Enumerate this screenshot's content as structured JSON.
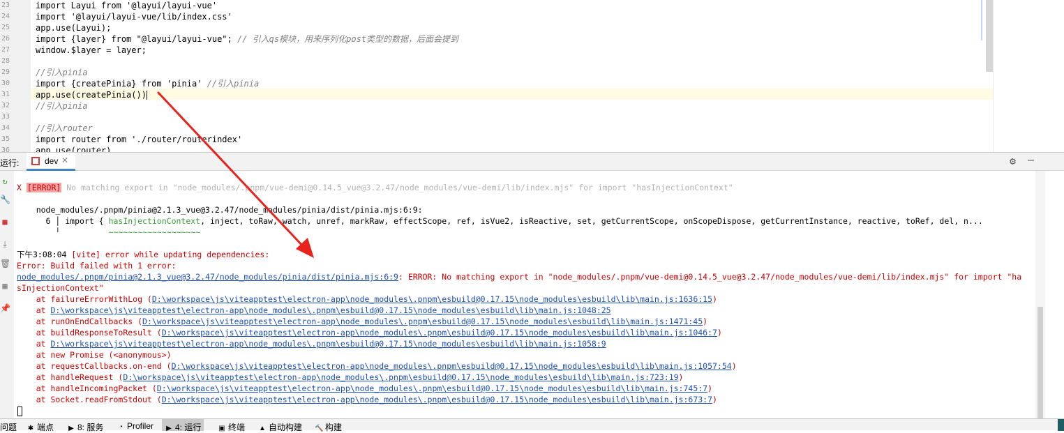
{
  "editor": {
    "line_numbers": [
      "23",
      "24",
      "25",
      "26",
      "27",
      "28",
      "29",
      "30",
      "31",
      "32",
      "33",
      "34",
      "35",
      "36"
    ],
    "lines": [
      {
        "code": "import Layui from '@layui/layui-vue'"
      },
      {
        "code": "import '@layui/layui-vue/lib/index.css'"
      },
      {
        "code": "app.use(Layui);"
      },
      {
        "code": "import {layer} from \"@layui/layui-vue\";",
        "comment": " // 引入qs模块，用来序列化post类型的数据，后面会提到"
      },
      {
        "code": "window.$layer = layer;"
      },
      {
        "code": ""
      },
      {
        "comment": "//引入pinia"
      },
      {
        "code": "import {createPinia} from 'pinia'",
        "comment": " //引入pinia"
      },
      {
        "code": "app.use(createPinia())"
      },
      {
        "comment": "//引入pinia"
      },
      {
        "code": ""
      },
      {
        "comment": "//引入router"
      },
      {
        "code": "import router from './router/routerindex'"
      },
      {
        "code": "app.use(router)"
      }
    ]
  },
  "run_panel": {
    "label": "运行:",
    "tab_label": "dev",
    "close_glyph": "✕",
    "settings_glyph": "⚙",
    "minimize_glyph": "—"
  },
  "console": {
    "line1": {
      "prefix": "X ",
      "badge": "[ERROR]",
      "rest": " No matching export in \"node_modules/.pnpm/vue-demi@0.14.5_vue@3.2.47/node_modules/vue-demi/lib/index.mjs\" for import \"hasInjectionContext\""
    },
    "line2": "    node_modules/.pnpm/pinia@2.1.3_vue@3.2.47/node_modules/pinia/dist/pinia.mjs:6:9:",
    "line3": {
      "prefix": "      6 │ import { ",
      "highlight": "hasInjectionContext",
      "rest": ", inject, toRaw, watch, unref, markRaw, effectScope, ref, isVue2, isReactive, set, getCurrentScope, onScopeDispose, getCurrentInstance, reactive, toRef, del, n..."
    },
    "line4": {
      "prefix": "        ╵          ",
      "wave": "~~~~~~~~~~~~~~~~~~~"
    },
    "line5": {
      "time": "下午3:08:04",
      "message": " [vite] error while updating dependencies:"
    },
    "line6": "Error: Build failed with 1 error:",
    "line7": {
      "link": "node_modules/.pnpm/pinia@2.1.3_vue@3.2.47/node_modules/pinia/dist/pinia.mjs:6:9",
      "rest": ": ERROR: No matching export in \"node_modules/.pnpm/vue-demi@0.14.5_vue@3.2.47/node_modules/vue-demi/lib/index.mjs\" for import \"ha"
    },
    "line8": "sInjectionContext\"",
    "stack": [
      {
        "at": "    at failureErrorWithLog (",
        "link": "D:\\workspace\\js\\viteapptest\\electron-app\\node_modules\\.pnpm\\esbuild@0.17.15\\node_modules\\esbuild\\lib\\main.js:1636:15",
        "end": ")"
      },
      {
        "at": "    at ",
        "link": "D:\\workspace\\js\\viteapptest\\electron-app\\node_modules\\.pnpm\\esbuild@0.17.15\\node_modules\\esbuild\\lib\\main.js:1048:25",
        "end": ""
      },
      {
        "at": "    at runOnEndCallbacks (",
        "link": "D:\\workspace\\js\\viteapptest\\electron-app\\node_modules\\.pnpm\\esbuild@0.17.15\\node_modules\\esbuild\\lib\\main.js:1471:45",
        "end": ")"
      },
      {
        "at": "    at buildResponseToResult (",
        "link": "D:\\workspace\\js\\viteapptest\\electron-app\\node_modules\\.pnpm\\esbuild@0.17.15\\node_modules\\esbuild\\lib\\main.js:1046:7",
        "end": ")"
      },
      {
        "at": "    at ",
        "link": "D:\\workspace\\js\\viteapptest\\electron-app\\node_modules\\.pnpm\\esbuild@0.17.15\\node_modules\\esbuild\\lib\\main.js:1058:9",
        "end": ""
      },
      {
        "at": "    at new Promise (<anonymous>)",
        "link": "",
        "end": ""
      },
      {
        "at": "    at requestCallbacks.on-end (",
        "link": "D:\\workspace\\js\\viteapptest\\electron-app\\node_modules\\.pnpm\\esbuild@0.17.15\\node_modules\\esbuild\\lib\\main.js:1057:54",
        "end": ")"
      },
      {
        "at": "    at handleRequest (",
        "link": "D:\\workspace\\js\\viteapptest\\electron-app\\node_modules\\.pnpm\\esbuild@0.17.15\\node_modules\\esbuild\\lib\\main.js:723:19",
        "end": ")"
      },
      {
        "at": "    at handleIncomingPacket (",
        "link": "D:\\workspace\\js\\viteapptest\\electron-app\\node_modules\\.pnpm\\esbuild@0.17.15\\node_modules\\esbuild\\lib\\main.js:745:7",
        "end": ")"
      },
      {
        "at": "    at Socket.readFromStdout (",
        "link": "D:\\workspace\\js\\viteapptest\\electron-app\\node_modules\\.pnpm\\esbuild@0.17.15\\node_modules\\esbuild\\lib\\main.js:673:7",
        "end": ")"
      }
    ]
  },
  "status_bar": {
    "problems": "问题",
    "breakpoints": "端点",
    "services": "8: 服务",
    "profiler": "Profiler",
    "run": "4: 运行",
    "terminal": "终端",
    "auto_build": "自动构建",
    "build": "构建"
  },
  "icons": {
    "rerun": "↻",
    "wrench": "🔧",
    "stop": "■",
    "scroll_end": "⤓",
    "trash": "🗑",
    "layout": "▦",
    "pin": "📌",
    "sb_breakpoints": "✱",
    "sb_services": "▶",
    "sb_profiler": "◔",
    "sb_run": "▶",
    "sb_terminal": "▣",
    "sb_auto_build": "▲",
    "sb_build": "🔨"
  },
  "colors": {
    "error_red": "#cc0000",
    "link_blue": "#1a4fb8",
    "keyword_navy": "#000080",
    "string_green": "#008000",
    "annotation_arrow": "#e8231d",
    "active_tab_underline": "#4083c9"
  }
}
